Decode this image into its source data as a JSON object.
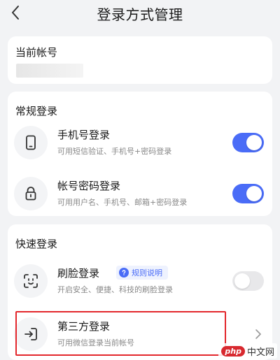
{
  "header": {
    "back_icon": "chevron-left-icon",
    "title": "登录方式管理"
  },
  "account": {
    "title": "当前帐号",
    "value_masked": true
  },
  "regular_login": {
    "title": "常规登录",
    "items": [
      {
        "icon": "phone-icon",
        "title": "手机号登录",
        "subtitle": "可用短信验证、手机号+密码登录",
        "enabled": true
      },
      {
        "icon": "lock-icon",
        "title": "帐号密码登录",
        "subtitle": "可用用户名、手机号、邮箱+密码登录",
        "enabled": true
      }
    ]
  },
  "quick_login": {
    "title": "快速登录",
    "face": {
      "icon": "face-scan-icon",
      "title": "刷脸登录",
      "rule_badge": "规则说明",
      "rule_icon": "question-icon",
      "subtitle": "开启安全、便捷、科技的刷脸登录",
      "enabled": false
    },
    "third_party": {
      "icon": "login-arrow-icon",
      "title": "第三方登录",
      "subtitle": "可用微信登录当前帐号",
      "chevron_icon": "chevron-right-icon"
    }
  },
  "watermark": {
    "logo": "php",
    "text": "中文网"
  },
  "colors": {
    "accent": "#4a6cf7",
    "toggle_off": "#e8e8ea",
    "highlight": "#e3272c",
    "background": "#f2f3f5"
  }
}
